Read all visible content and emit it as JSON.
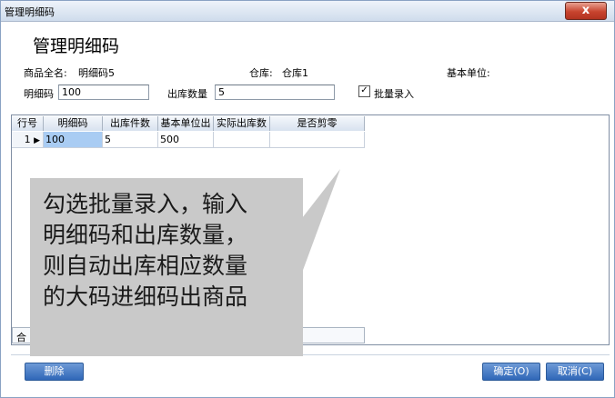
{
  "window": {
    "title": "管理明细码",
    "close_glyph": "x"
  },
  "heading": "管理明细码",
  "info": {
    "product_label": "商品全名:",
    "product_value": "明细码5",
    "warehouse_label": "仓库:",
    "warehouse_value": "仓库1",
    "base_unit_label": "基本单位:"
  },
  "form": {
    "detail_code_label": "明细码",
    "detail_code_value": "100",
    "out_qty_label": "出库数量",
    "out_qty_value": "5",
    "batch_label": "批量录入",
    "batch_checked": true,
    "check_glyph": "✓"
  },
  "grid": {
    "columns": [
      "行号",
      "明细码",
      "出库件数",
      "基本单位出",
      "实际出库数",
      "是否剪零"
    ],
    "rows": [
      {
        "row_no": "1",
        "marker": "▶",
        "detail_code": "100",
        "out_pieces": "5",
        "base_unit_out": "500",
        "actual_out": "",
        "is_cut": ""
      }
    ],
    "summary_label": "合"
  },
  "buttons": {
    "delete": "删除",
    "ok": "确定(O)",
    "cancel": "取消(C)"
  },
  "callout": {
    "lines": [
      "勾选批量录入，输入",
      "明细码和出库数量，",
      "则自动出库相应数量",
      "的大码进细码出商品"
    ]
  },
  "colors": {
    "accent": "#2f67b8",
    "selected_cell": "#a9ccf3",
    "callout_bg": "#c9c9c9"
  }
}
